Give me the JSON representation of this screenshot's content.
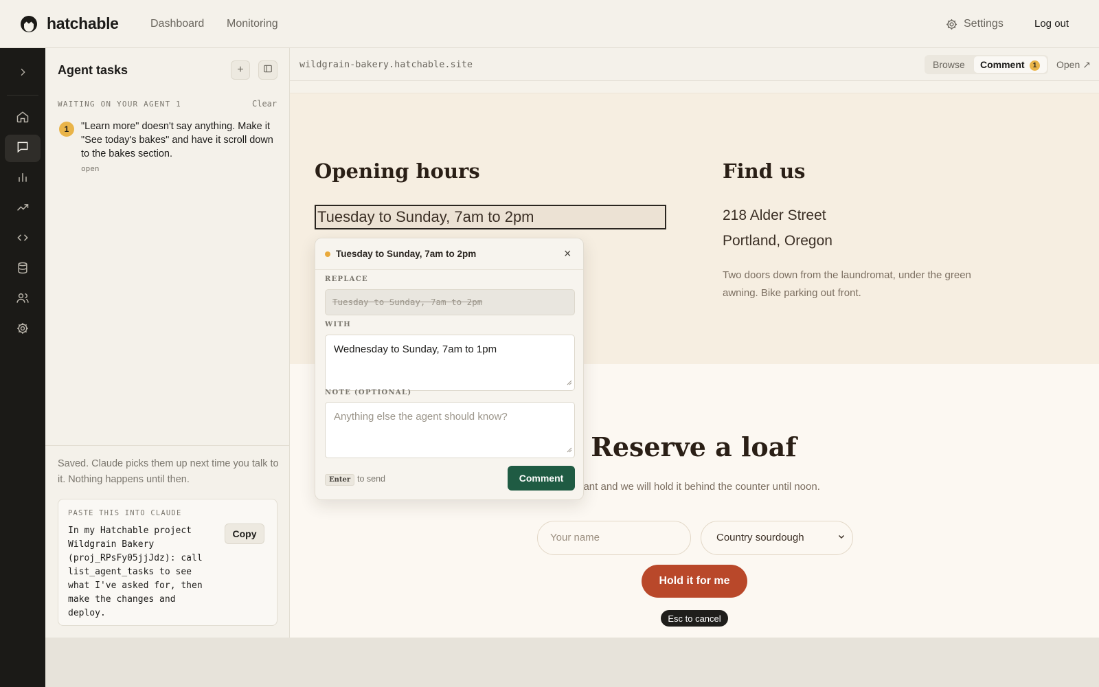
{
  "app": {
    "brand": "hatchable",
    "nav": [
      "Dashboard",
      "Monitoring"
    ],
    "settings_label": "Settings",
    "logout_label": "Log out",
    "accent_color": "#1f5b43",
    "badge_color": "#e9b449"
  },
  "rail": {
    "icons": [
      "chevron-right-icon",
      "home-icon",
      "chat-icon",
      "bar-chart-icon",
      "trending-icon",
      "code-icon",
      "database-icon",
      "users-icon",
      "gear-icon"
    ],
    "active": "chat-icon"
  },
  "panel": {
    "title": "Agent tasks",
    "add_symbol": "+",
    "section_label": "WAITING ON YOUR AGENT 1",
    "clear_label": "Clear",
    "tasks": [
      {
        "number": "1",
        "text": "\"Learn more\" doesn't say anything. Make it \"See today's bakes\" and have it scroll down to the bakes section.",
        "status": "open"
      }
    ],
    "saved_note": "Saved. Claude picks them up next time you talk to it. Nothing happens until then.",
    "paste_label": "PASTE THIS INTO CLAUDE",
    "paste_code": "In my Hatchable project\nWildgrain Bakery\n(proj_RPsFy05jjJdz): call\nlist_agent_tasks to see\nwhat I've asked for, then\nmake the changes and\ndeploy.",
    "copy_label": "Copy"
  },
  "preview": {
    "url": "wildgrain-bakery.hatchable.site",
    "mode_browse": "Browse",
    "mode_comment": "Comment",
    "comment_count": "1",
    "open_label": "Open ↗"
  },
  "site": {
    "opening_title": "Opening hours",
    "hours": "Tuesday to Sunday, 7am to 2pm",
    "find_title": "Find us",
    "address_line1": "218 Alder Street",
    "address_line2": "Portland, Oregon",
    "address_note": "Two doors down from the laundromat, under the green awning. Bike parking out front.",
    "reserve_title": "Reserve a loaf",
    "reserve_sub": "u want and we will hold it behind the counter until noon.",
    "name_placeholder": "Your name",
    "loaf_selected": "Country sourdough",
    "hold_label": "Hold it for me",
    "esc_hint": "Esc to cancel"
  },
  "popover": {
    "title": "Tuesday to Sunday, 7am to 2pm",
    "replace_label": "REPLACE",
    "replace_value": "Tuesday to Sunday, 7am to 2pm",
    "with_label": "WITH",
    "with_value": "Wednesday to Sunday, 7am to 1pm",
    "note_label": "NOTE (OPTIONAL)",
    "note_placeholder": "Anything else the agent should know?",
    "enter_key": "Enter",
    "send_hint": "to send",
    "submit_label": "Comment",
    "close_symbol": "×"
  }
}
